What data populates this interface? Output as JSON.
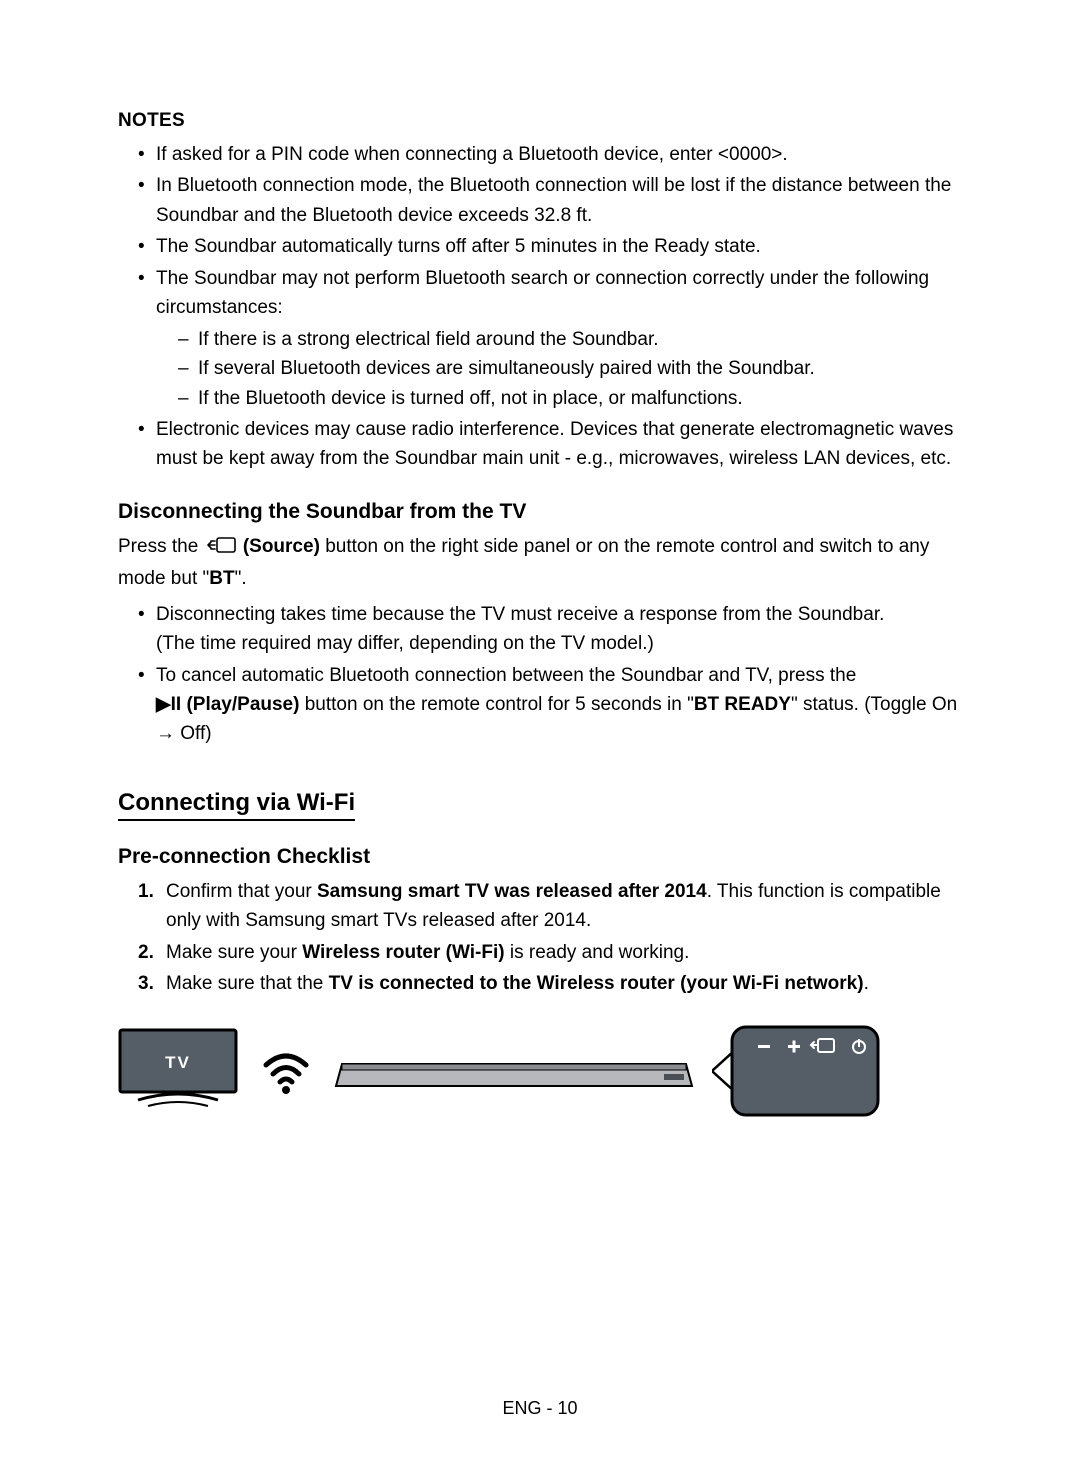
{
  "notes": {
    "heading": "NOTES",
    "bullets": [
      {
        "text": "If asked for a PIN code when connecting a Bluetooth device, enter <0000>."
      },
      {
        "text": "In Bluetooth connection mode, the Bluetooth connection will be lost if the distance between the Soundbar and the Bluetooth device exceeds 32.8 ft."
      },
      {
        "text": "The Soundbar automatically turns off after 5 minutes in the Ready state."
      },
      {
        "text": "The Soundbar may not perform Bluetooth search or connection correctly under the following circumstances:",
        "sub": [
          "If there is a strong electrical field around the Soundbar.",
          "If several Bluetooth devices are simultaneously paired with the Soundbar.",
          "If the Bluetooth device is turned off, not in place, or malfunctions."
        ]
      },
      {
        "text": "Electronic devices may cause radio interference. Devices that generate electromagnetic waves must be kept away from the Soundbar main unit - e.g., microwaves, wireless LAN devices, etc."
      }
    ]
  },
  "disconnect": {
    "heading": "Disconnecting the Soundbar from the TV",
    "line1_a": "Press the ",
    "source_label": "(Source)",
    "line1_b": " button on the right side panel or on the remote control and switch to any mode but \"",
    "bt": "BT",
    "line1_c": "\".",
    "bullets": [
      {
        "a": "Disconnecting takes time because the TV must receive a response from the Soundbar.",
        "b": "(The time required may differ, depending on the TV model.)"
      },
      {
        "a": "To cancel automatic Bluetooth connection between the Soundbar and TV, press the ",
        "playpause": "▶II (Play/Pause)",
        "b": " button on the remote control for 5 seconds in \"",
        "btready": "BT READY",
        "c": "\" status. (Toggle On → Off)"
      }
    ]
  },
  "wifi": {
    "heading": "Connecting via Wi-Fi",
    "sub": "Pre-connection Checklist",
    "items": [
      {
        "a": "Confirm that your ",
        "bold": "Samsung smart TV was released after 2014",
        "b": ". This function is compatible only with Samsung smart TVs released after 2014."
      },
      {
        "a": "Make sure your ",
        "bold": "Wireless router (Wi-Fi)",
        "b": " is ready and working."
      },
      {
        "a": "Make sure that the ",
        "bold": "TV is connected to the Wireless router (your Wi-Fi network)",
        "b": "."
      }
    ],
    "diagram_tv_label": "TV"
  },
  "footer": "ENG - 10"
}
